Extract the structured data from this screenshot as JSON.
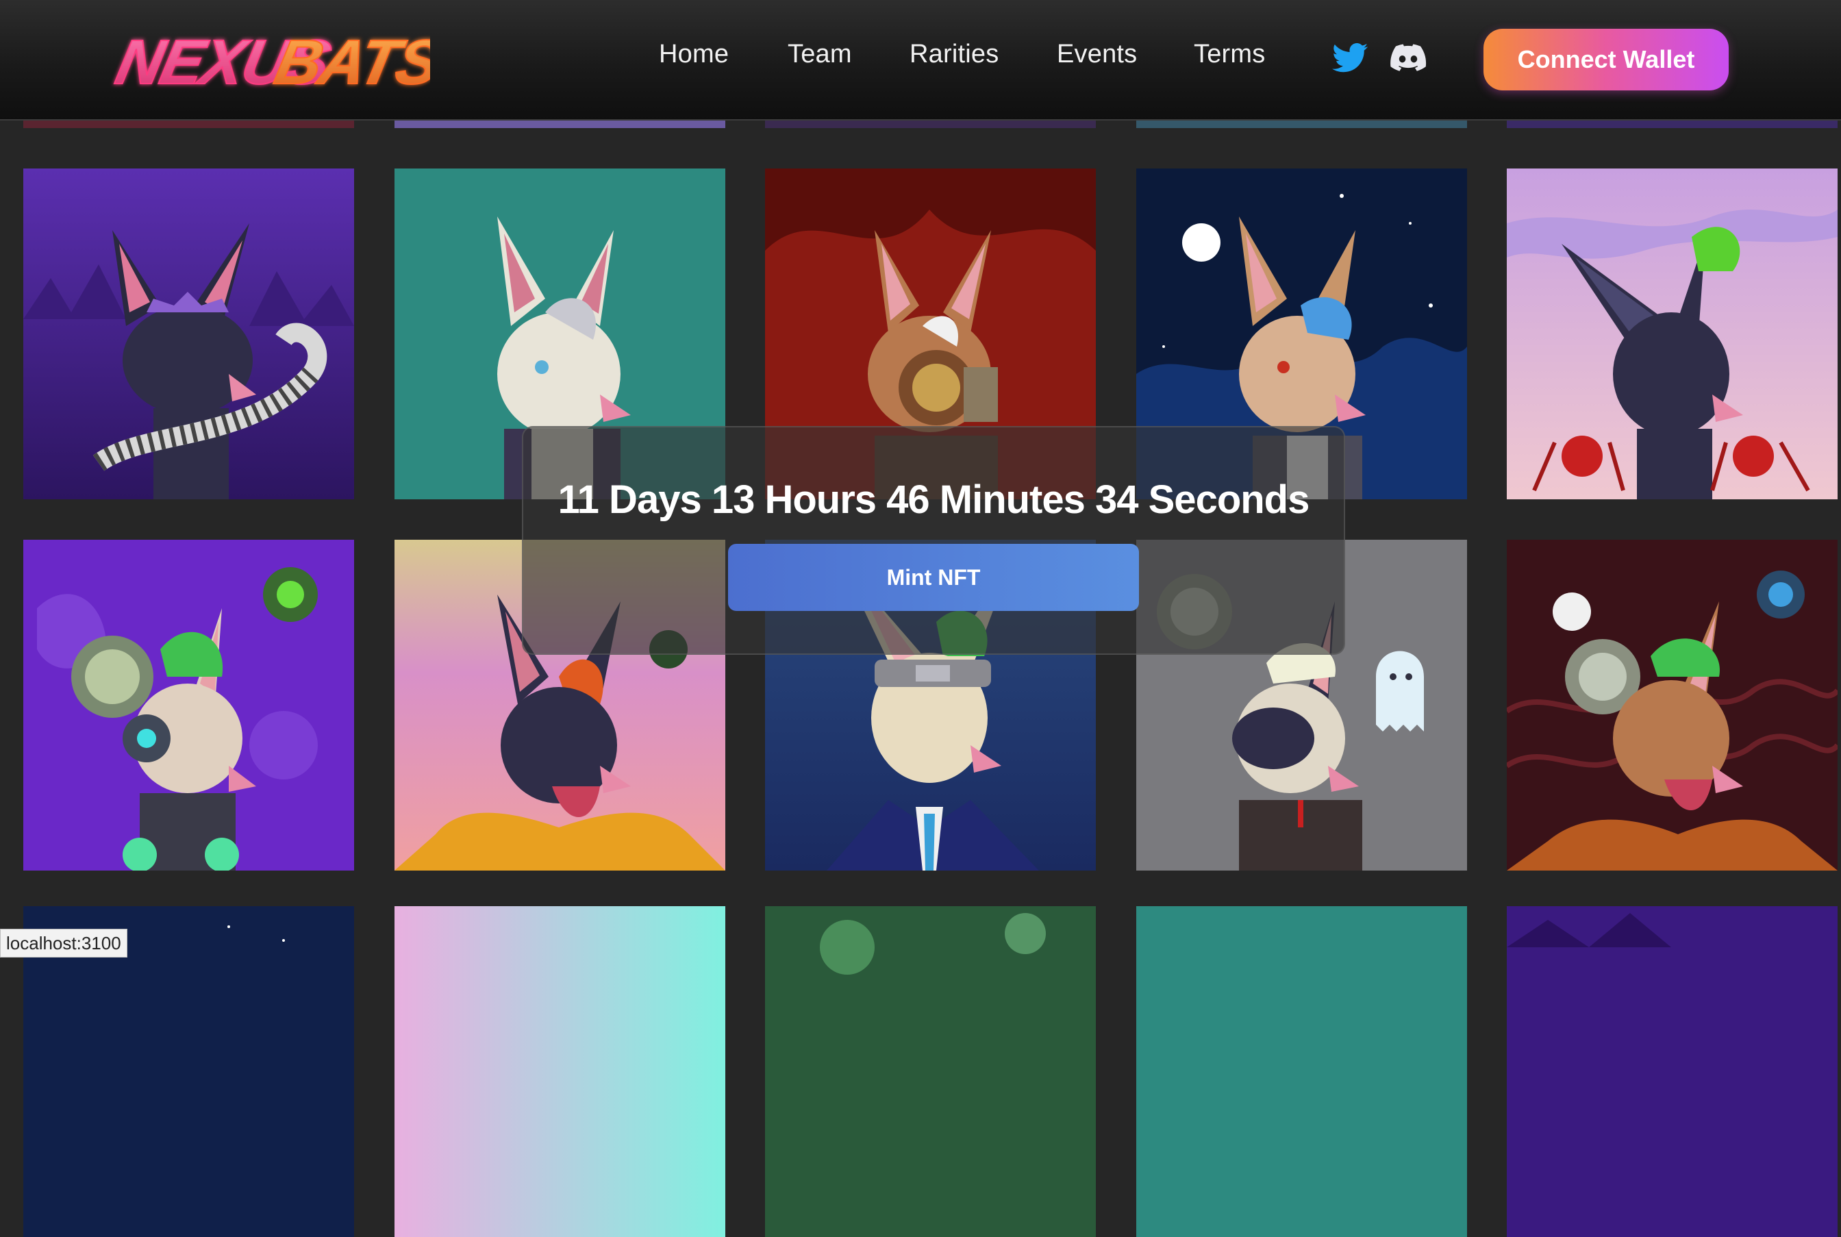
{
  "brand": {
    "logo_text": "NEXUSBATS",
    "logo_part1": "NEXUS",
    "logo_part2": "BATS"
  },
  "nav": {
    "links": [
      {
        "label": "Home"
      },
      {
        "label": "Team"
      },
      {
        "label": "Rarities"
      },
      {
        "label": "Events"
      },
      {
        "label": "Terms"
      }
    ],
    "social": {
      "twitter_icon": "twitter-icon",
      "discord_icon": "discord-icon"
    },
    "connect_label": "Connect Wallet"
  },
  "mint_panel": {
    "countdown": "11 Days 13 Hours 46 Minutes 34 Seconds",
    "mint_label": "Mint NFT"
  },
  "gallery": {
    "tiles": [
      {
        "name": "bat-purple-forest-snake"
      },
      {
        "name": "bat-teal-white-hair"
      },
      {
        "name": "bat-red-forest-gasmask"
      },
      {
        "name": "bat-night-sky-blue-hair"
      },
      {
        "name": "bat-pink-sky-green-hair"
      },
      {
        "name": "bat-purple-ghosts-cyborg"
      },
      {
        "name": "bat-sunset-orange-hair"
      },
      {
        "name": "bat-blue-suit-headband"
      },
      {
        "name": "bat-grey-ghost-white-hair"
      },
      {
        "name": "bat-red-night-green-hair"
      }
    ]
  },
  "colors": {
    "page_bg": "#262626",
    "connect_gradient": [
      "#f58b3a",
      "#e85aa0",
      "#c94ef0"
    ],
    "mint_gradient": [
      "#4c6fcf",
      "#5a8fe0"
    ],
    "logo_pink": "#ff4a86",
    "logo_orange": "#ff8a33"
  },
  "status_bar": {
    "url": "localhost:3100"
  }
}
